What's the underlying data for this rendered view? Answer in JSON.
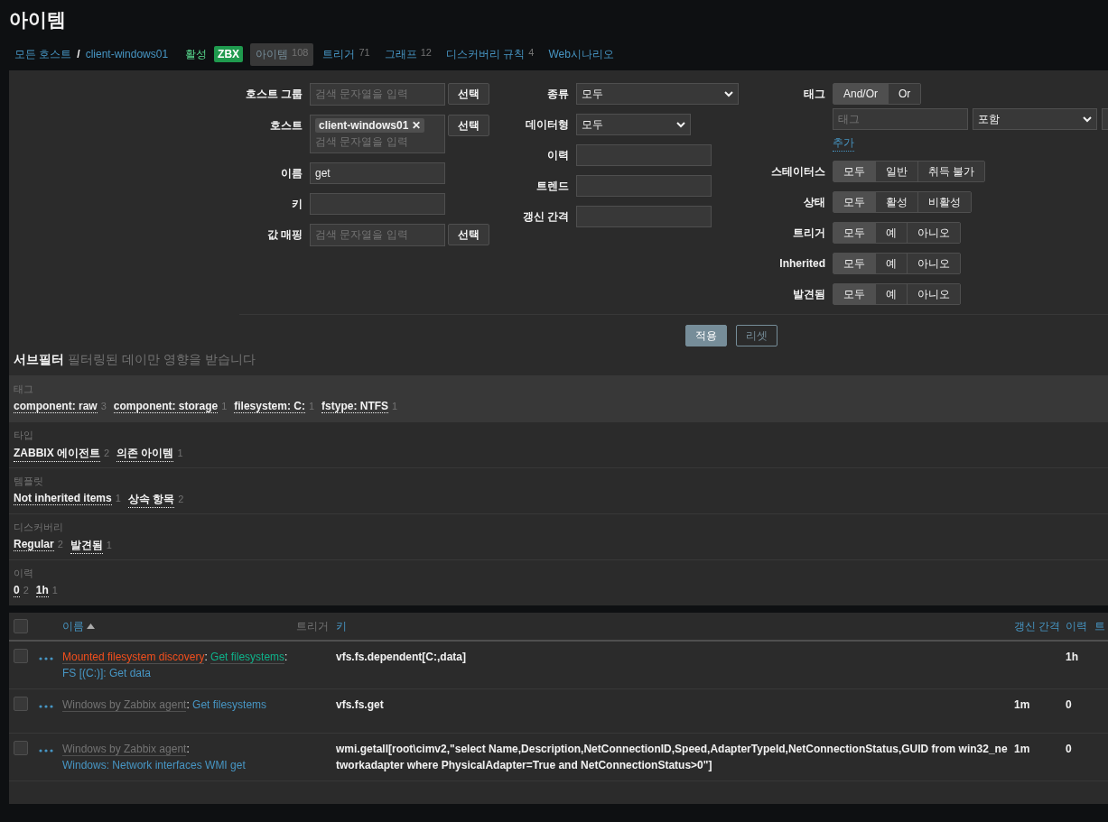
{
  "page_title": "아이템",
  "breadcrumbs": {
    "separator": "/",
    "items": [
      {
        "label": "모든 호스트"
      },
      {
        "label": "client-windows01"
      }
    ]
  },
  "nav": [
    {
      "kind": "status",
      "label": "활성"
    },
    {
      "kind": "badge",
      "label": "ZBX"
    },
    {
      "kind": "link",
      "label": "아이템",
      "count": "108",
      "selected": true
    },
    {
      "kind": "link",
      "label": "트리거",
      "count": "71",
      "selected": false
    },
    {
      "kind": "link",
      "label": "그래프",
      "count": "12",
      "selected": false
    },
    {
      "kind": "link",
      "label": "디스커버리 규칙",
      "count": "4",
      "selected": false
    },
    {
      "kind": "link",
      "label": "Web시나리오",
      "selected": false
    }
  ],
  "filter": {
    "column_1": [
      {
        "kind": "multiselect",
        "label": "호스트 그룹",
        "placeholder": "검색 문자열을 입력",
        "button": "선택"
      },
      {
        "kind": "multiselect",
        "label": "호스트",
        "chips": [
          {
            "label": "client-windows01",
            "remove": "✕"
          }
        ],
        "placeholder": "검색 문자열을 입력",
        "button": "선택"
      },
      {
        "kind": "text",
        "label": "이름",
        "value": "get"
      },
      {
        "kind": "text",
        "label": "키"
      },
      {
        "kind": "multiselect",
        "label": "값 매핑",
        "placeholder": "검색 문자열을 입력",
        "button": "선택"
      }
    ],
    "column_2": [
      {
        "kind": "select",
        "label": "종류",
        "value": "모두",
        "wide": true
      },
      {
        "kind": "select",
        "label": "데이터형",
        "value": "모두",
        "wide": false
      },
      {
        "kind": "text",
        "label": "이력"
      },
      {
        "kind": "text",
        "label": "트렌드"
      },
      {
        "kind": "text",
        "label": "갱신 간격"
      }
    ],
    "tags": {
      "label": "태그",
      "options": [
        {
          "label": "And/Or",
          "selected": true
        },
        {
          "label": "Or",
          "selected": false
        }
      ],
      "tag_placeholder": "태그",
      "operator": "포함",
      "add": "추가"
    },
    "segments": [
      {
        "label": "스테이터스",
        "options": [
          {
            "label": "모두",
            "selected": true
          },
          {
            "label": "일반",
            "selected": false
          },
          {
            "label": "취득 불가",
            "selected": false
          }
        ]
      },
      {
        "label": "상태",
        "options": [
          {
            "label": "모두",
            "selected": true
          },
          {
            "label": "활성",
            "selected": false
          },
          {
            "label": "비활성",
            "selected": false
          }
        ]
      },
      {
        "label": "트리거",
        "options": [
          {
            "label": "모두",
            "selected": true
          },
          {
            "label": "예",
            "selected": false
          },
          {
            "label": "아니오",
            "selected": false
          }
        ]
      },
      {
        "label": "Inherited",
        "options": [
          {
            "label": "모두",
            "selected": true
          },
          {
            "label": "예",
            "selected": false
          },
          {
            "label": "아니오",
            "selected": false
          }
        ]
      },
      {
        "label": "발견됨",
        "options": [
          {
            "label": "모두",
            "selected": true
          },
          {
            "label": "예",
            "selected": false
          },
          {
            "label": "아니오",
            "selected": false
          }
        ]
      }
    ],
    "buttons": [
      {
        "kind": "primary",
        "label": "적용"
      },
      {
        "kind": "secondary",
        "label": "리셋"
      }
    ]
  },
  "subfilter": {
    "title": "서브필터",
    "note": "필터링된 데이만 영향을 받습니다",
    "groups": [
      {
        "label": "태그",
        "highlighted": true,
        "items": [
          {
            "label": "component: raw",
            "count": "3"
          },
          {
            "label": "component: storage",
            "count": "1"
          },
          {
            "label": "filesystem: C:",
            "count": "1"
          },
          {
            "label": "fstype: NTFS",
            "count": "1"
          }
        ]
      },
      {
        "label": "타입",
        "highlighted": false,
        "items": [
          {
            "label": "ZABBIX 에이전트",
            "count": "2"
          },
          {
            "label": "의존 아이템",
            "count": "1"
          }
        ]
      },
      {
        "label": "템플릿",
        "highlighted": false,
        "items": [
          {
            "label": "Not inherited items",
            "count": "1"
          },
          {
            "label": "상속 항목",
            "count": "2"
          }
        ]
      },
      {
        "label": "디스커버리",
        "highlighted": false,
        "items": [
          {
            "label": "Regular",
            "count": "2"
          },
          {
            "label": "발견됨",
            "count": "1"
          }
        ]
      },
      {
        "label": "이력",
        "highlighted": false,
        "items": [
          {
            "label": "0",
            "count": "2"
          },
          {
            "label": "1h",
            "count": "1"
          }
        ]
      }
    ]
  },
  "table": {
    "select_all_checked": false,
    "separator": ":",
    "columns": [
      {
        "label": "이름",
        "sortable": true,
        "sorted": true
      },
      {
        "label": "트리거",
        "sortable": false,
        "sorted": false
      },
      {
        "label": "키",
        "sortable": true,
        "sorted": false
      },
      {
        "label": "갱신 간격",
        "sortable": true,
        "sorted": false
      },
      {
        "label": "이력",
        "sortable": true,
        "sorted": false
      },
      {
        "label": "트",
        "sortable": true,
        "sorted": false
      }
    ],
    "rows": [
      {
        "checked": false,
        "name": [
          {
            "kind": "discovery",
            "text": "Mounted filesystem discovery"
          },
          {
            "kind": "master",
            "text": "Get filesystems"
          },
          {
            "kind": "item",
            "text": "FS [(C:)]: Get data"
          }
        ],
        "key": "vfs.fs.dependent[C:,data]",
        "history": "1h"
      },
      {
        "checked": false,
        "name": [
          {
            "kind": "template",
            "text": "Windows by Zabbix agent"
          },
          {
            "kind": "item",
            "text": "Get filesystems"
          }
        ],
        "key": "vfs.fs.get",
        "interval": "1m",
        "history": "0"
      },
      {
        "checked": false,
        "name": [
          {
            "kind": "template",
            "text": "Windows by Zabbix agent"
          },
          {
            "kind": "item",
            "text": "Windows: Network interfaces WMI get"
          }
        ],
        "key": "wmi.getall[root\\cimv2,\"select Name,Description,NetConnectionID,Speed,AdapterTypeId,NetConnectionStatus,GUID from win32_networkadapter where PhysicalAdapter=True and NetConnectionStatus>0\"]",
        "interval": "1m",
        "history": "0"
      }
    ]
  }
}
